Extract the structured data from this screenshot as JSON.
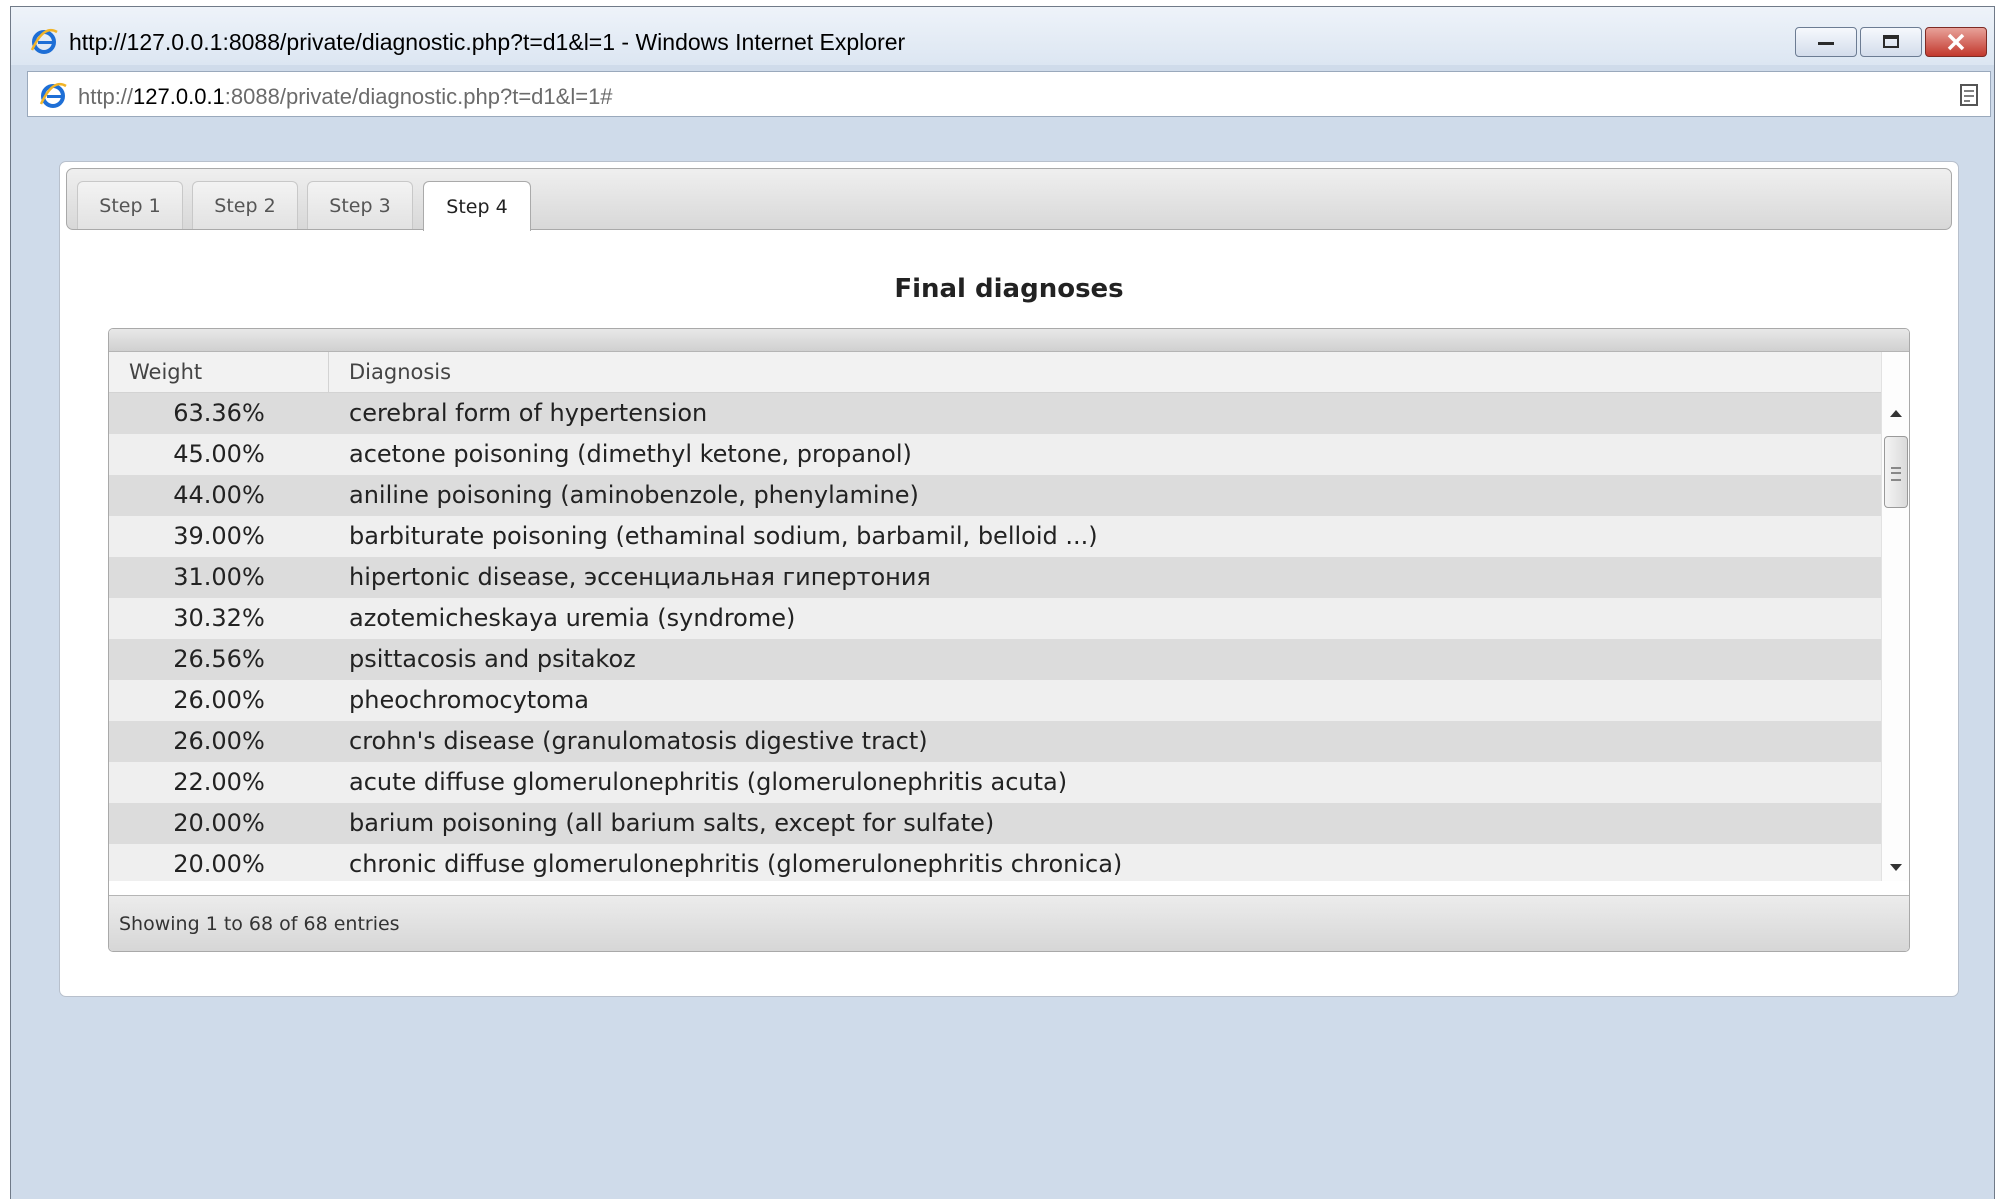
{
  "window": {
    "title": "http://127.0.0.1:8088/private/diagnostic.php?t=d1&l=1 - Windows Internet Explorer"
  },
  "address_bar": {
    "prefix": "http://",
    "host": "127.0.0.1",
    "rest": ":8088/private/diagnostic.php?t=d1&l=1#"
  },
  "tabs": [
    {
      "label": "Step 1",
      "active": false
    },
    {
      "label": "Step 2",
      "active": false
    },
    {
      "label": "Step 3",
      "active": false
    },
    {
      "label": "Step 4",
      "active": true
    }
  ],
  "main": {
    "title": "Final diagnoses"
  },
  "table": {
    "columns": [
      "Weight",
      "Diagnosis"
    ],
    "rows": [
      {
        "weight": "63.36%",
        "diagnosis": "cerebral form of hypertension"
      },
      {
        "weight": "45.00%",
        "diagnosis": "acetone poisoning  (dimethyl ketone, propanol)"
      },
      {
        "weight": "44.00%",
        "diagnosis": "aniline poisoning (aminobenzole, phenylamine)"
      },
      {
        "weight": "39.00%",
        "diagnosis": "barbiturate poisoning (ethaminal sodium, barbamil, belloid ...)"
      },
      {
        "weight": "31.00%",
        "diagnosis": "hipertonic disease, эссенциальная гипертония"
      },
      {
        "weight": "30.32%",
        "diagnosis": "azotemicheskaya uremia (syndrome)"
      },
      {
        "weight": "26.56%",
        "diagnosis": "psittacosis and psitakoz"
      },
      {
        "weight": "26.00%",
        "diagnosis": "pheochromocytoma"
      },
      {
        "weight": "26.00%",
        "diagnosis": "crohn's disease (granulomatosis digestive tract)"
      },
      {
        "weight": "22.00%",
        "diagnosis": "acute diffuse glomerulonephritis (glomerulonephritis acuta)"
      },
      {
        "weight": "20.00%",
        "diagnosis": "barium poisoning (all barium salts, except for sulfate)"
      },
      {
        "weight": "20.00%",
        "diagnosis": "chronic diffuse glomerulonephritis (glomerulonephritis chronica)"
      }
    ],
    "footer": "Showing 1 to 68 of 68 entries"
  },
  "icons": {
    "browser": "ie-logo-icon",
    "minimize": "minimize-icon",
    "restore": "restore-icon",
    "close": "close-icon",
    "compat": "compatibility-view-icon"
  },
  "colors": {
    "window_frame": "#cfdbea",
    "close_button": "#c2382d",
    "ie_blue": "#1e6fd6",
    "row_odd": "#dcdcdc",
    "row_even": "#efefef"
  }
}
